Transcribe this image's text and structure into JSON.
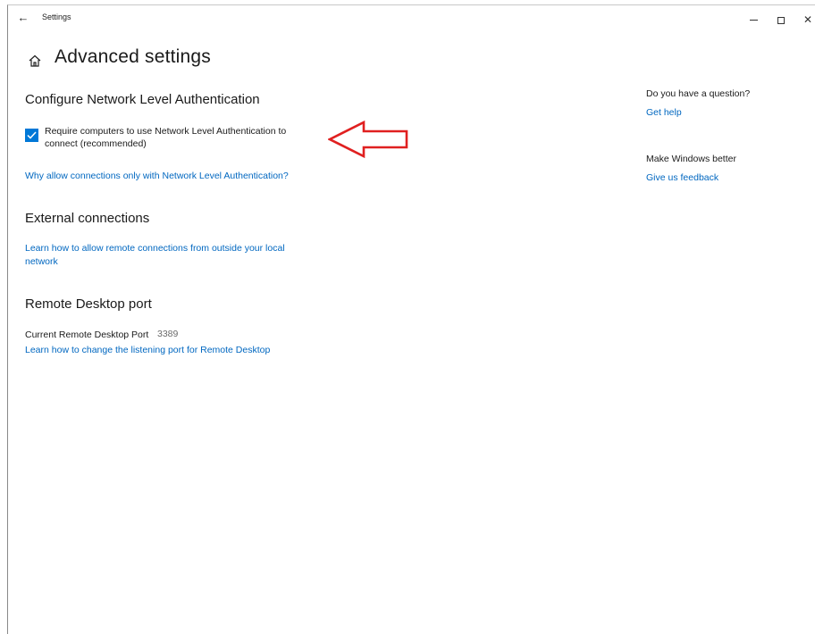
{
  "window": {
    "title": "Settings",
    "back_icon": "arrow-left-icon",
    "controls": [
      "minimize",
      "maximize",
      "close"
    ]
  },
  "header": {
    "home_icon": "home-icon",
    "title": "Advanced settings"
  },
  "nla": {
    "heading": "Configure Network Level Authentication",
    "checkbox_checked": true,
    "checkbox_label_line1": "Require computers to use Network Level Authentication to",
    "checkbox_label_line2": "connect (recommended)",
    "why_link": "Why allow connections only with Network Level Authentication?"
  },
  "external": {
    "heading": "External connections",
    "link_line1": "Learn how to allow remote connections from outside your local",
    "link_line2": "network"
  },
  "port": {
    "heading": "Remote Desktop port",
    "label": "Current Remote Desktop Port",
    "value": "3389",
    "link": "Learn how to change the listening port for Remote Desktop"
  },
  "sidebar": {
    "question_heading": "Do you have a question?",
    "help_link": "Get help",
    "better_heading": "Make Windows better",
    "feedback_link": "Give us feedback"
  },
  "colors": {
    "accent": "#0078d7",
    "link": "#0067c0",
    "annotation_arrow": "#e02020"
  }
}
